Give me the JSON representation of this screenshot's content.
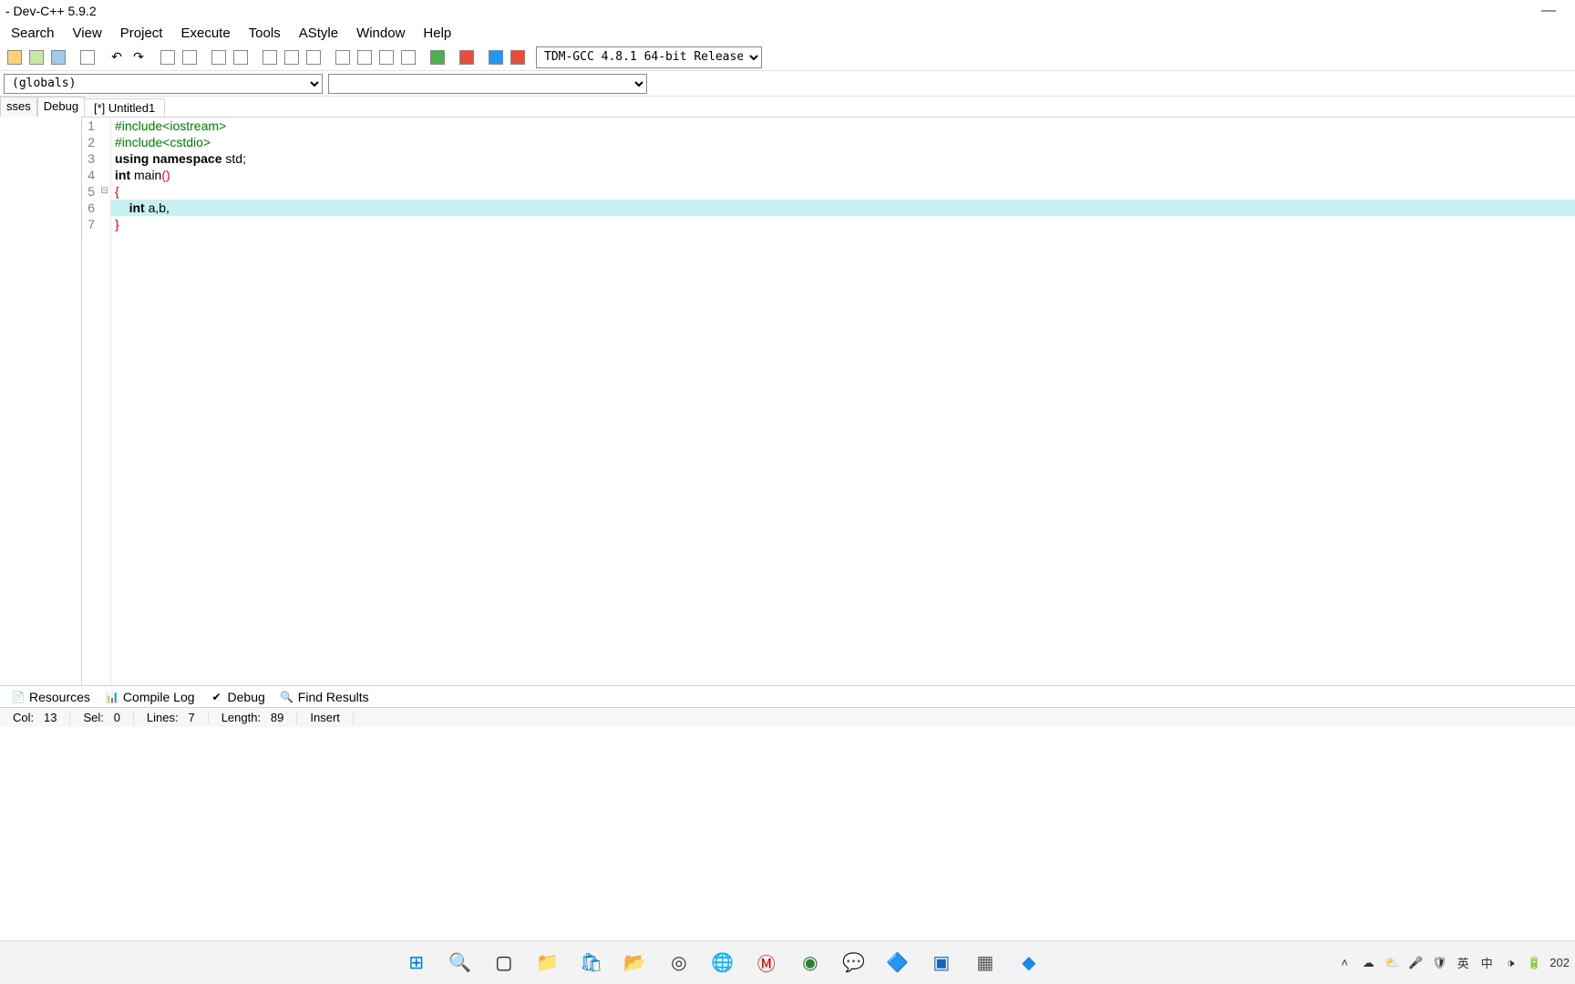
{
  "title": " - Dev-C++ 5.9.2",
  "menubar": [
    "Search",
    "View",
    "Project",
    "Execute",
    "Tools",
    "AStyle",
    "Window",
    "Help"
  ],
  "compiler_selected": "TDM-GCC 4.8.1 64-bit Release",
  "scope_selected": "(globals)",
  "side_tabs": {
    "left": "sses",
    "right": "Debug"
  },
  "file_tab": "[*] Untitled1",
  "code_lines": [
    {
      "n": 1,
      "tokens": [
        {
          "c": "pp",
          "t": "#include"
        },
        {
          "c": "pp",
          "t": "<iostream>"
        }
      ]
    },
    {
      "n": 2,
      "tokens": [
        {
          "c": "pp",
          "t": "#include"
        },
        {
          "c": "pp",
          "t": "<cstdio>"
        }
      ]
    },
    {
      "n": 3,
      "tokens": [
        {
          "c": "kw",
          "t": "using "
        },
        {
          "c": "kw",
          "t": "namespace "
        },
        {
          "c": "id",
          "t": "std"
        },
        {
          "c": "id",
          "t": ";"
        }
      ]
    },
    {
      "n": 4,
      "tokens": [
        {
          "c": "kw",
          "t": "int "
        },
        {
          "c": "id",
          "t": "main"
        },
        {
          "c": "pn",
          "t": "()"
        }
      ]
    },
    {
      "n": 5,
      "tokens": [
        {
          "c": "br",
          "t": "{"
        }
      ],
      "fold": "⊟"
    },
    {
      "n": 6,
      "tokens": [
        {
          "c": "id",
          "t": "    "
        },
        {
          "c": "kw",
          "t": "int "
        },
        {
          "c": "id",
          "t": "a,b,"
        }
      ],
      "highlight": true
    },
    {
      "n": 7,
      "tokens": [
        {
          "c": "br",
          "t": "}"
        }
      ]
    }
  ],
  "bottom_tabs": [
    "Resources",
    "Compile Log",
    "Debug",
    "Find Results"
  ],
  "status": {
    "col_label": "Col:",
    "col": "13",
    "sel_label": "Sel:",
    "sel": "0",
    "lines_label": "Lines:",
    "lines": "7",
    "length_label": "Length:",
    "length": "89",
    "mode": "Insert"
  },
  "tray": {
    "ime1": "英",
    "ime2": "中",
    "clock": "202"
  }
}
